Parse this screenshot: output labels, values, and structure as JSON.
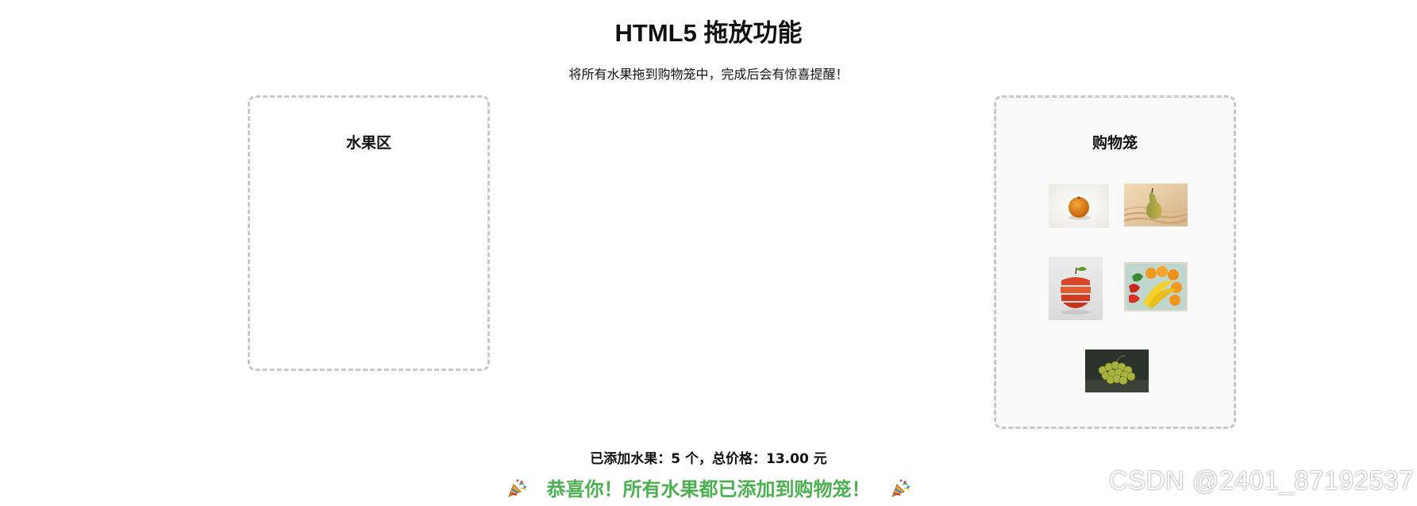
{
  "title": "HTML5 拖放功能",
  "instructions": "将所有水果拖到购物笼中，完成后会有惊喜提醒！",
  "fruit_zone": {
    "title": "水果区",
    "items": []
  },
  "cart_zone": {
    "title": "购物笼",
    "items": [
      "orange",
      "pear",
      "apple",
      "mixed-fruit-basket",
      "grapes"
    ]
  },
  "summary": "已添加水果：5 个，总价格：13.00 元",
  "congrats": {
    "text": "恭喜你！所有水果都已添加到购物笼！",
    "icon": "party-popper-icon"
  },
  "watermark": "CSDN @2401_87192537",
  "colors": {
    "congrats": "#4caf50",
    "zone_border": "#c8c8c8",
    "cart_background": "#f9f9f9"
  }
}
